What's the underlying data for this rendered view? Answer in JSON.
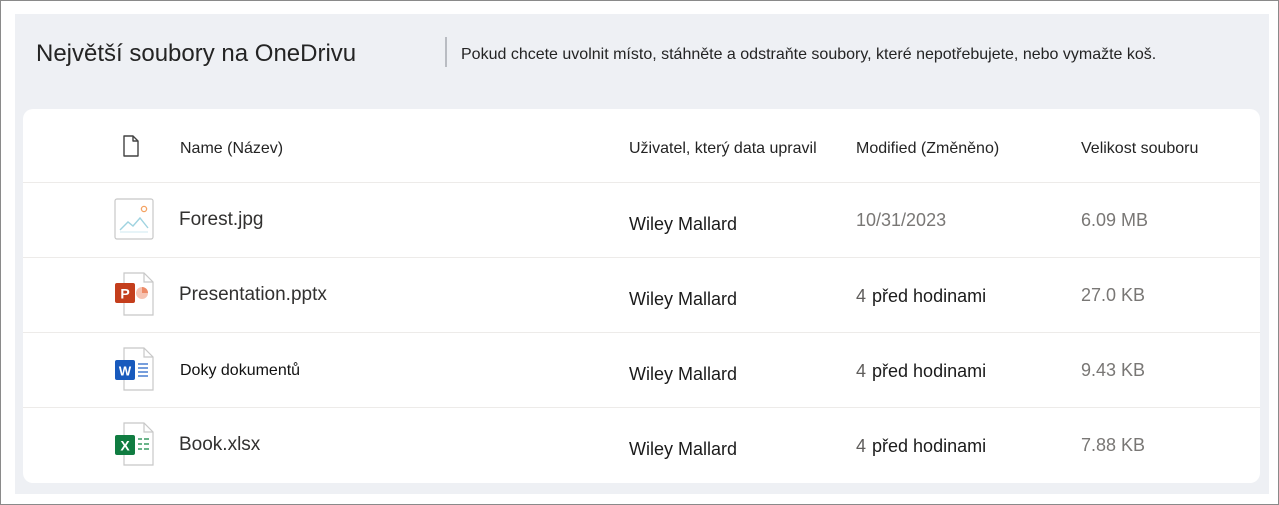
{
  "header": {
    "title": "Největší soubory na OneDrivu",
    "description": "Pokud chcete uvolnit místo, stáhněte a odstraňte soubory, které nepotřebujete, nebo vymažte koš."
  },
  "table": {
    "columns": {
      "type_icon": "file-type-icon",
      "name": "Name (Název)",
      "modified_by": "Uživatel, který data upravil",
      "modified": "Modified (Změněno)",
      "size": "Velikost souboru"
    },
    "rows": [
      {
        "icon": "image-file-icon",
        "name": "Forest.jpg",
        "modified_by": "Wiley Mallard",
        "modified_num": "",
        "modified_text": "10/31/2023",
        "size": "6.09 MB"
      },
      {
        "icon": "powerpoint-file-icon",
        "name": "Presentation.pptx",
        "modified_by": "Wiley Mallard",
        "modified_num": "4",
        "modified_text": "před hodinami",
        "size": "27.0 KB"
      },
      {
        "icon": "word-file-icon",
        "name": "Doky dokumentů",
        "modified_by": "Wiley Mallard",
        "modified_num": "4",
        "modified_text": "před hodinami",
        "size": "9.43 KB"
      },
      {
        "icon": "excel-file-icon",
        "name": "Book.xlsx",
        "modified_by": "Wiley Mallard",
        "modified_num": "4",
        "modified_text": "před hodinami",
        "size": "7.88 KB"
      }
    ]
  },
  "colors": {
    "panel_bg": "#eef0f4",
    "powerpoint": "#c43e1c",
    "word": "#185abd",
    "excel": "#107c41"
  }
}
